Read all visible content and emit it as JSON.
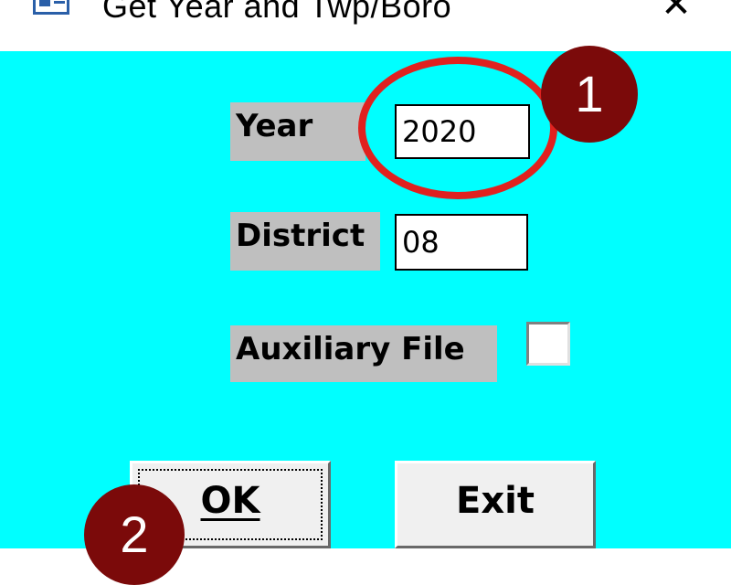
{
  "window": {
    "title": "Get Year and Twp/Boro",
    "close_glyph": "✕",
    "icon": "form-window-icon"
  },
  "form": {
    "year": {
      "label": "Year",
      "value": "2020"
    },
    "district": {
      "label": "District",
      "value": "08"
    },
    "auxiliary": {
      "label": "Auxiliary File",
      "checked": false
    }
  },
  "buttons": {
    "ok": "OK",
    "exit": "Exit"
  },
  "callouts": [
    {
      "number": "1"
    },
    {
      "number": "2"
    }
  ],
  "colors": {
    "background": "#00ffff",
    "label_bg": "#bfbfbf",
    "callout_ring": "#e0211f",
    "callout_badge": "#7b0a0a"
  }
}
